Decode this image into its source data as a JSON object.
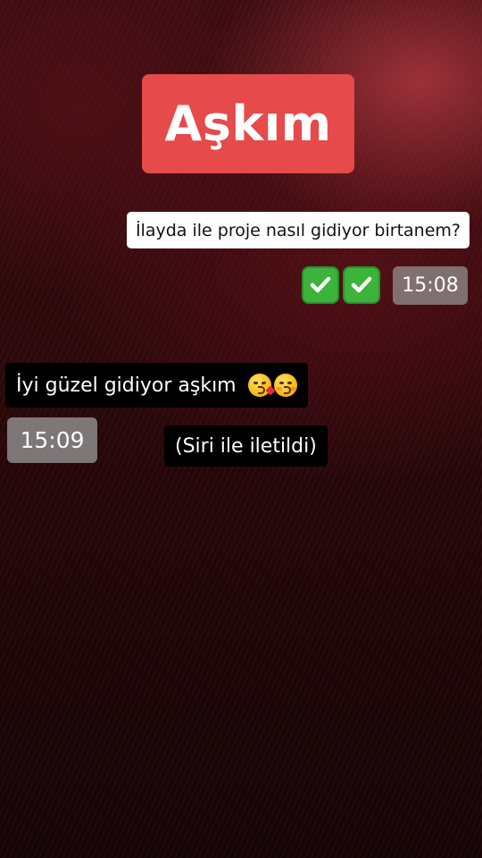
{
  "title": "Aşkım",
  "messages": {
    "question": "İlayda ile proje nasıl gidiyor birtanem?",
    "question_time": "15:08",
    "answer": "İyi güzel gidiyor aşkım",
    "answer_time": "15:09",
    "siri_note": "(Siri ile iletildi)"
  },
  "icons": {
    "check": "check-mark-button-icon",
    "emoji_1": "face-blowing-kiss-icon",
    "emoji_2": "kissing-face-with-smiling-eyes-icon"
  },
  "colors": {
    "title_badge": "#e64a4a",
    "check_green": "#3cb33b",
    "timestamp_bg": "#969696"
  }
}
